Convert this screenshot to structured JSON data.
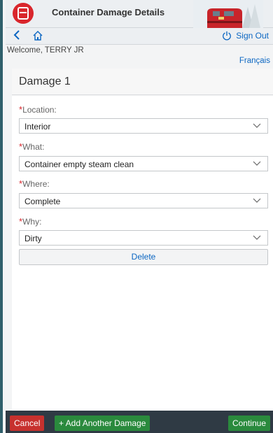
{
  "app": {
    "title": "Container Damage Details",
    "logo_icon": "railway-logo-icon"
  },
  "nav": {
    "back_icon": "chevron-left-icon",
    "home_icon": "home-icon",
    "sign_out_label": "Sign Out"
  },
  "user": {
    "welcome_text": "Welcome, TERRY JR"
  },
  "language_link": "Français",
  "damage": {
    "title": "Damage 1",
    "fields": [
      {
        "label": "Location:",
        "value": "Interior"
      },
      {
        "label": "What:",
        "value": "Container empty steam clean"
      },
      {
        "label": "Where:",
        "value": "Complete"
      },
      {
        "label": "Why:",
        "value": "Dirty"
      }
    ],
    "delete_label": "Delete"
  },
  "footer": {
    "cancel_label": "Cancel",
    "add_label": "+ Add Another Damage",
    "continue_label": "Continue"
  },
  "colors": {
    "accent": "#0b66c2",
    "danger": "#c7312e",
    "success": "#2a8a3d",
    "required": "#d9262c"
  }
}
